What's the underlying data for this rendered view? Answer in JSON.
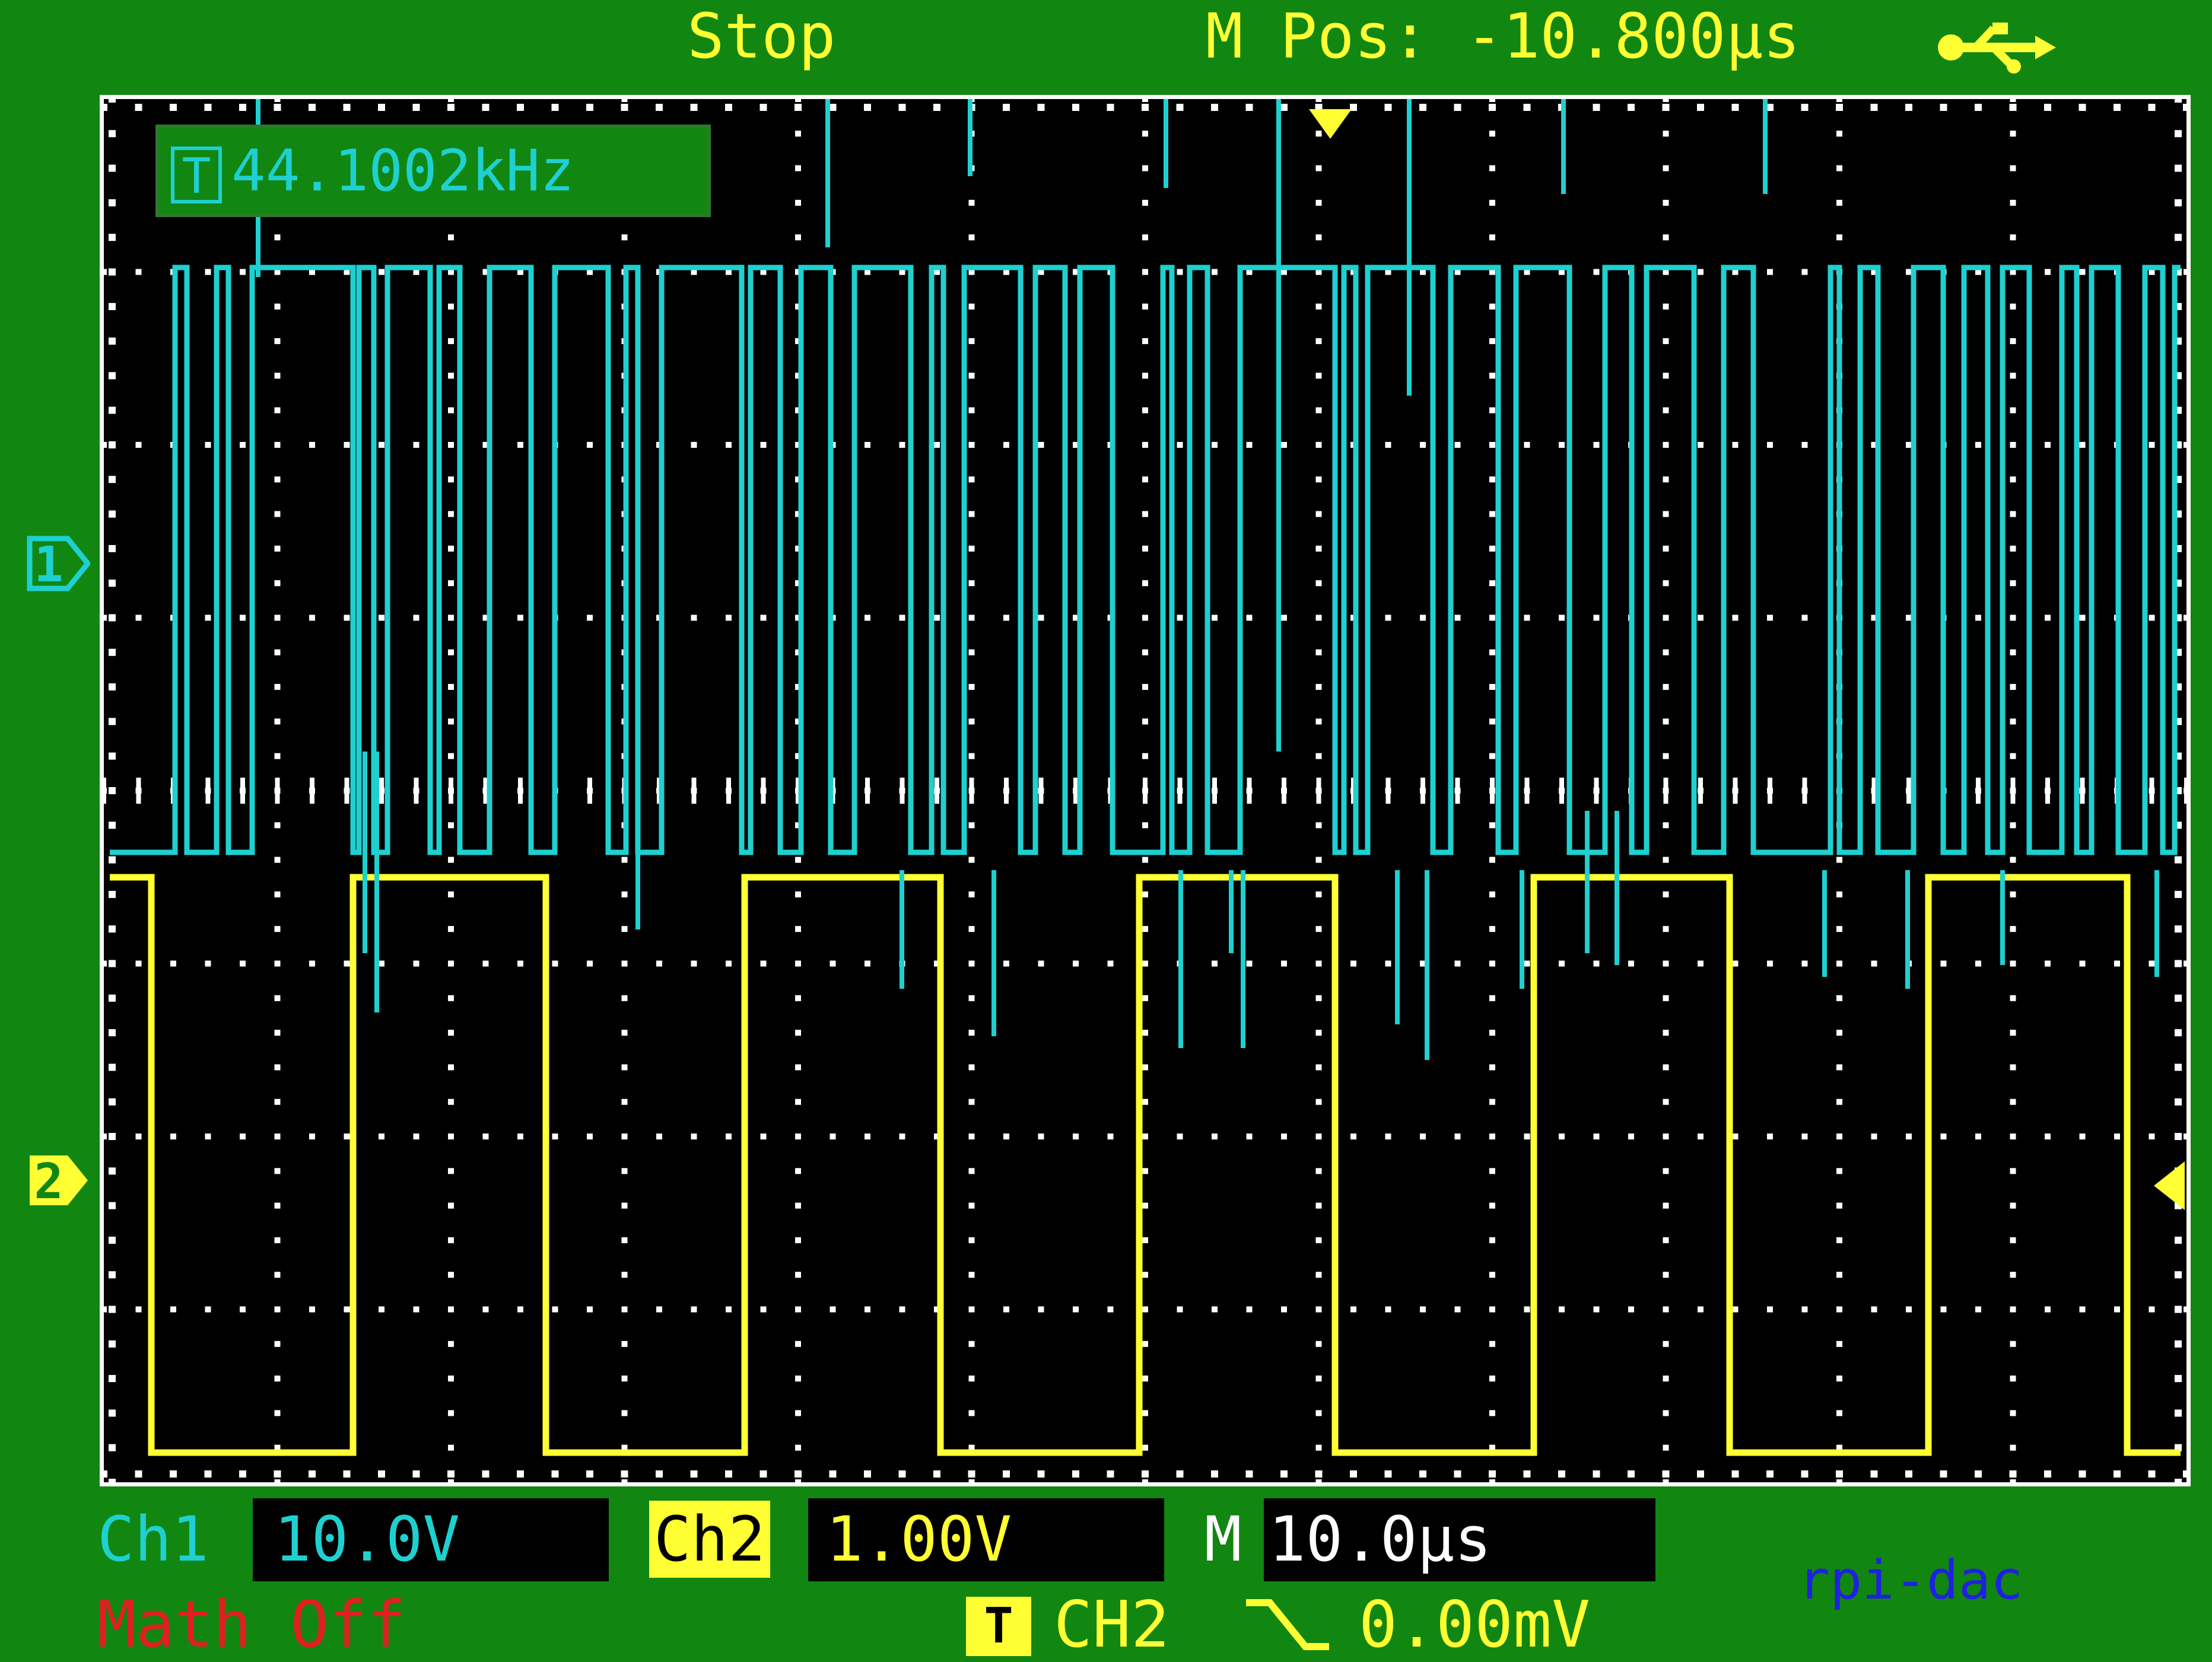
{
  "header": {
    "status": "Stop",
    "m_pos": "M Pos: -10.800µs",
    "usb_icon": "usb-icon"
  },
  "measurement": {
    "trigger_box_label": "T",
    "frequency": "44.1002kHz"
  },
  "channels": {
    "ch1": {
      "label": "Ch1",
      "scale": "10.0V",
      "marker": "1",
      "color": "#1fd0d0"
    },
    "ch2": {
      "label": "Ch2",
      "scale": "1.00V",
      "marker": "2",
      "color": "#ffff33"
    }
  },
  "timebase": {
    "label": "M",
    "value": "10.0µs"
  },
  "math": {
    "status": "Math Off"
  },
  "trigger": {
    "icon_label": "T",
    "source": "CH2",
    "slope_icon": "falling-edge-icon",
    "level": "0.00mV"
  },
  "watermark": "rpi-dac",
  "colors": {
    "bezel": "#118611",
    "screen": "#000000",
    "grid": "#ffffff",
    "alert": "#e02020"
  }
}
